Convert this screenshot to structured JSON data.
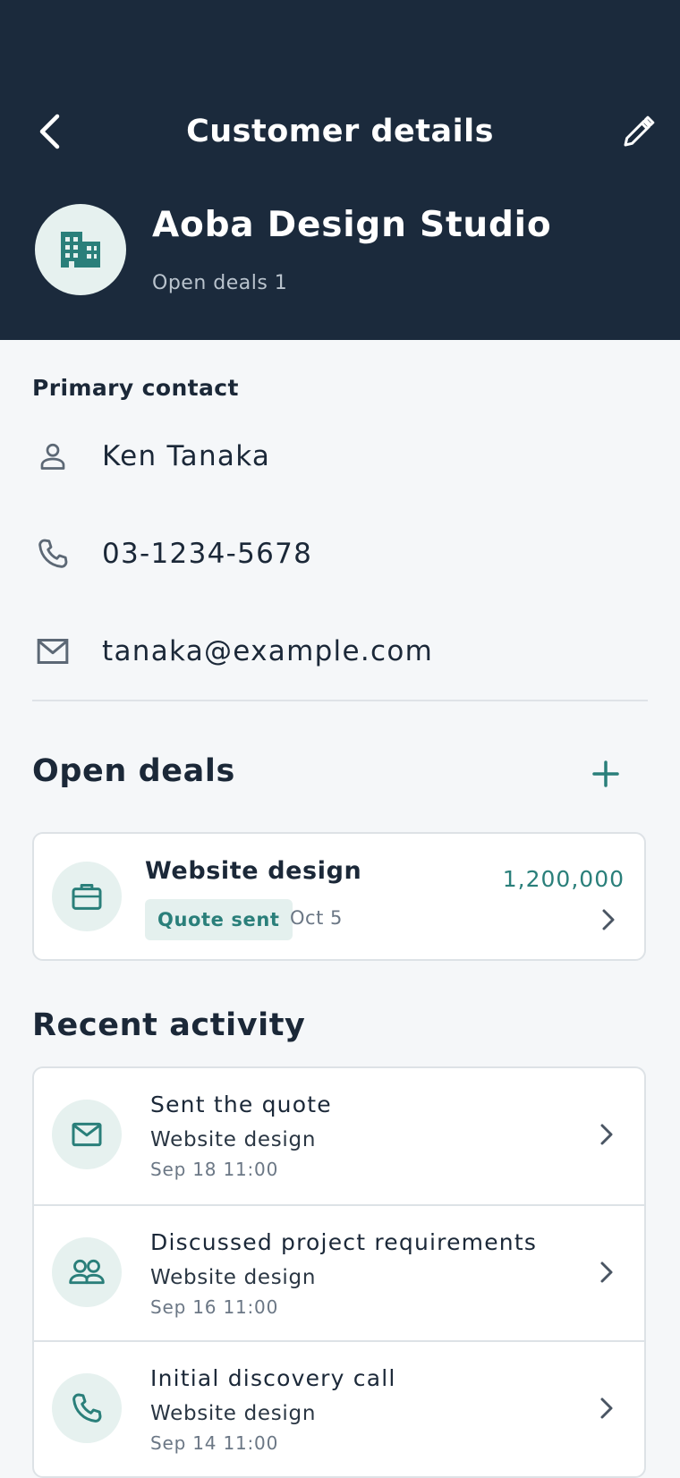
{
  "header": {
    "title": "Customer details",
    "back_icon": "chevron-left-icon",
    "edit_icon": "pencil-icon",
    "background": "#1b2a3c"
  },
  "customer": {
    "name": "Aoba Design Studio",
    "open_deals_summary": "Open deals 1",
    "avatar_icon": "building-icon"
  },
  "primary_contact": {
    "label": "Primary contact",
    "name": "Ken Tanaka",
    "phone": "03-1234-5678",
    "email": "tanaka@example.com"
  },
  "open_deals": {
    "title": "Open deals",
    "add_icon": "plus-icon",
    "deals": [
      {
        "title": "Website design",
        "status": "Quote sent",
        "date": "Oct 5",
        "amount": "1,200,000",
        "icon": "briefcase-icon"
      }
    ]
  },
  "recent_activity": {
    "title": "Recent activity",
    "items": [
      {
        "title": "Sent the quote",
        "subtitle": "Website design",
        "time": "Sep 18 11:00",
        "icon": "mail-icon"
      },
      {
        "title": "Discussed project requirements",
        "subtitle": "Website design",
        "time": "Sep 16 11:00",
        "icon": "people-icon"
      },
      {
        "title": "Initial discovery call",
        "subtitle": "Website design",
        "time": "Sep 14 11:00",
        "icon": "phone-icon"
      }
    ]
  },
  "colors": {
    "accent": "#2a7f7a",
    "badge_bg": "#e4f0ee",
    "icon_circle": "#e6f1ef",
    "page_bg": "#f5f7f9"
  }
}
